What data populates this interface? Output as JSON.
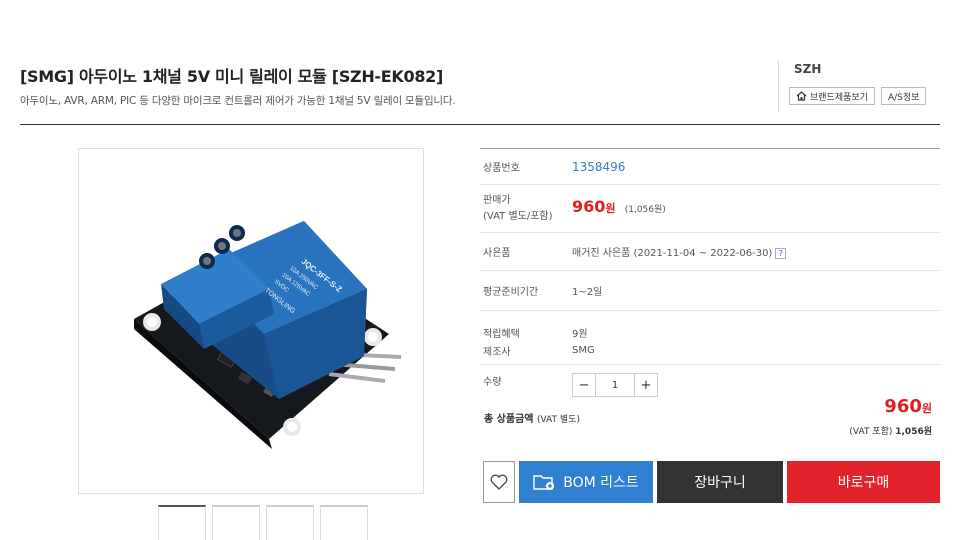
{
  "product": {
    "title": "[SMG] 아두이노 1채널 5V 미니 릴레이 모듈 [SZH-EK082]",
    "subtitle": "아두이노, AVR, ARM, PIC 등 다양한 마이크로 컨트롤러 제어가 가능한 1채널 5V 릴레이 모듈입니다."
  },
  "brand": {
    "name": "SZH",
    "view_products_label": "브랜드제품보기",
    "as_info_label": "A/S정보"
  },
  "relay_markings": {
    "model": "JQC-3FF-S-Z",
    "rating1": "10A 250VAC",
    "rating2": "10A 125VAC",
    "voltage": "SVDC",
    "maker": "TONGLING"
  },
  "info": {
    "code_label": "상품번호",
    "code_value": "1358496",
    "price_label_1": "판매가",
    "price_label_2": "(VAT 별도/포함)",
    "price_value": "960",
    "price_unit": "원",
    "price_vat": "(1,056원)",
    "gift_label": "사은품",
    "gift_value": "매거진 사은품 (2021-11-04 ~ 2022-06-30)",
    "gift_help": "?",
    "prep_label": "평균준비기간",
    "prep_value": "1~2일",
    "points_label": "적립혜택",
    "points_value": "9원",
    "maker_label": "제조사",
    "maker_value": "SMG",
    "qty_label": "수량",
    "qty_minus": "−",
    "qty_value": "1",
    "qty_plus": "+"
  },
  "total": {
    "label": "총 상품금액",
    "label_vat": "(VAT 별도)",
    "price": "960",
    "unit": "원",
    "vat_label": "(VAT 포함)",
    "vat_price": "1,056원"
  },
  "actions": {
    "bom_label": "BOM 리스트",
    "cart_label": "장바구니",
    "buy_label": "바로구매"
  },
  "colors": {
    "price_red": "#e02020",
    "link_blue": "#3a7cc4",
    "bom_blue": "#2f80d1",
    "cart_dark": "#333333",
    "buy_red": "#e3232b"
  }
}
